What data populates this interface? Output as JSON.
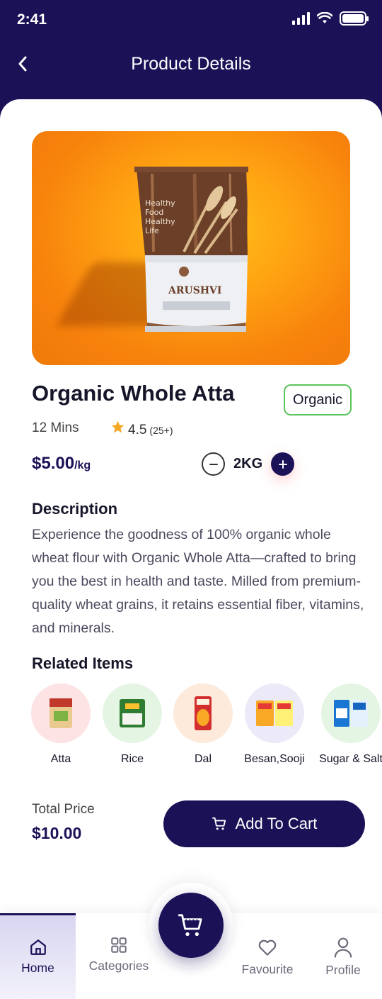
{
  "status_bar": {
    "time": "2:41"
  },
  "header": {
    "title": "Product Details"
  },
  "product": {
    "name": "Organic Whole Atta",
    "badge": "Organic",
    "delivery_time": "12 Mins",
    "rating": "4.5",
    "rating_count": "(25+)",
    "price": "$5.00",
    "price_unit": "/kg",
    "quantity": "2KG",
    "package": {
      "brand": "ARUSHVI",
      "tagline": "Healthy Food Healthy Life"
    }
  },
  "description": {
    "heading": "Description",
    "text": "Experience the goodness of 100% organic whole wheat flour with Organic Whole Atta—crafted to bring you the best in health and taste. Milled from premium-quality wheat grains, it retains essential fiber, vitamins, and minerals."
  },
  "related": {
    "heading": "Related Items",
    "items": [
      {
        "label": "Atta"
      },
      {
        "label": "Rice"
      },
      {
        "label": "Dal"
      },
      {
        "label": "Besan,Sooji"
      },
      {
        "label": "Sugar & Salt"
      }
    ]
  },
  "total": {
    "label": "Total Price",
    "value": "$10.00"
  },
  "cart_button": {
    "label": "Add To Cart"
  },
  "nav": {
    "home": "Home",
    "categories": "Categories",
    "favourite": "Favourite",
    "profile": "Profile"
  },
  "colors": {
    "primary": "#1a1157",
    "accent_orange": "#f7820c",
    "badge_green": "#5bc45b",
    "star": "#f5a623"
  }
}
